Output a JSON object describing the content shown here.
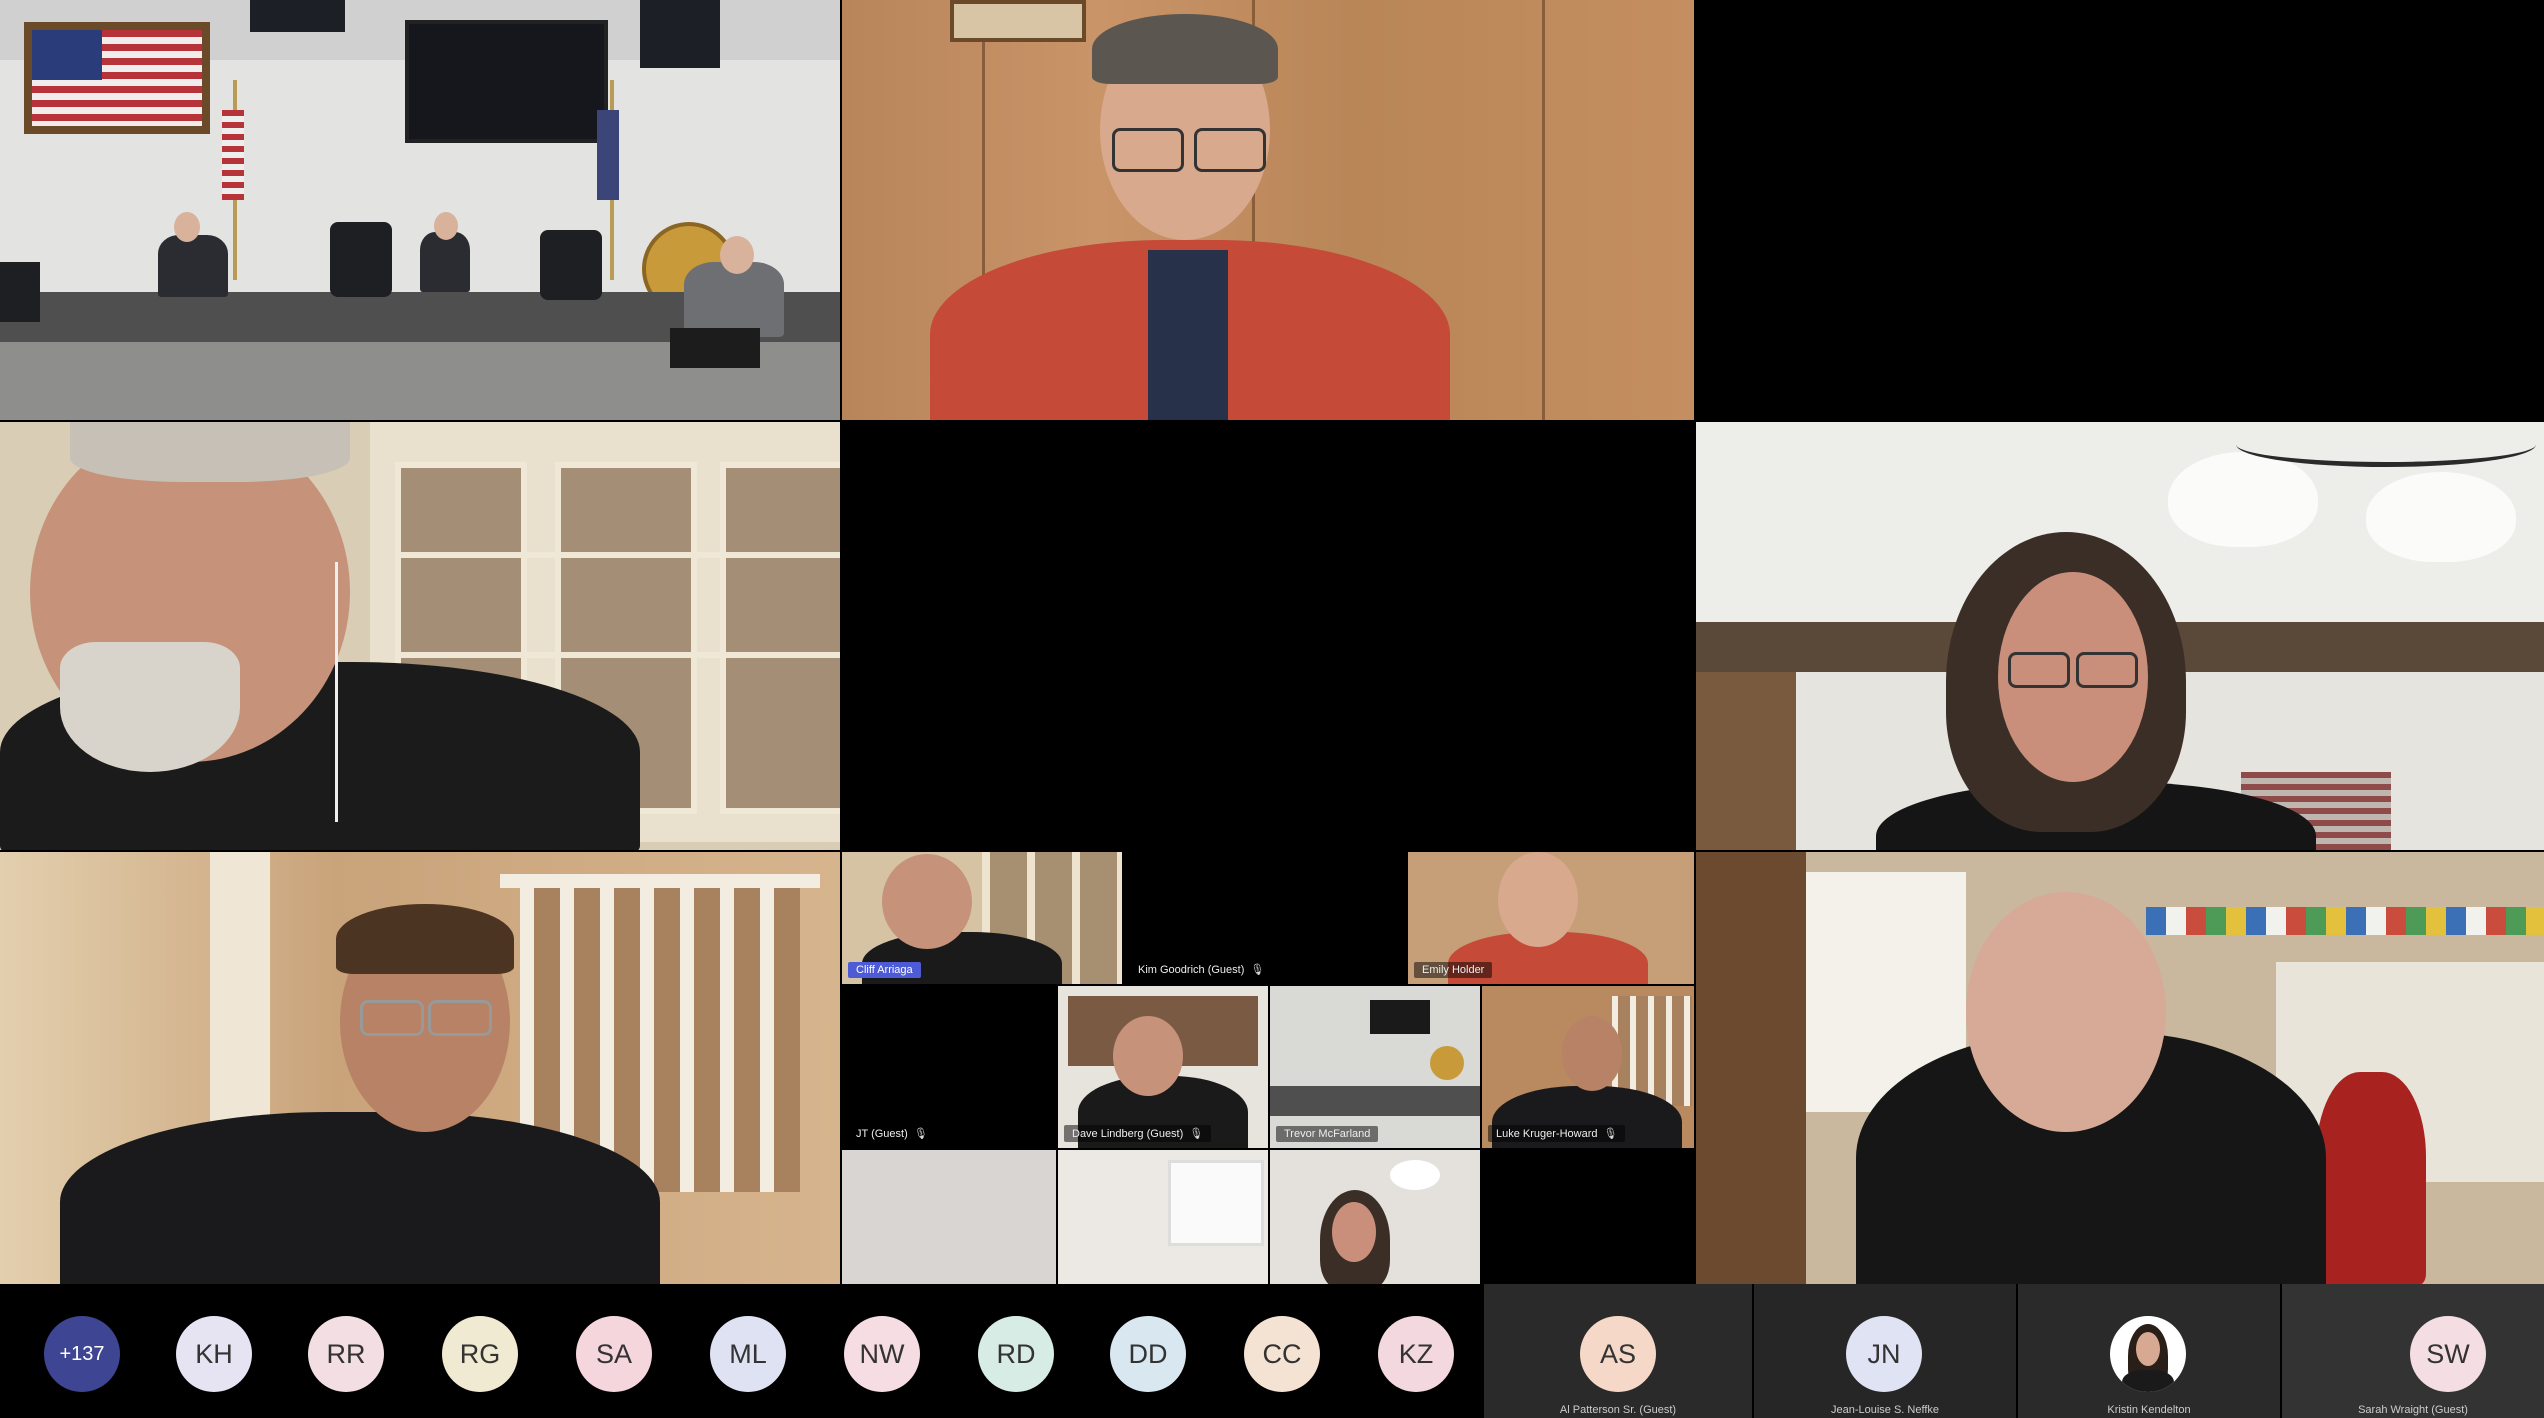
{
  "participants_small": [
    {
      "name": "Cliff Arriaga",
      "highlight": true
    },
    {
      "name": "Kim Goodrich (Guest)"
    },
    {
      "name": "Emily Holder"
    },
    {
      "name": "JT (Guest)"
    },
    {
      "name": "Dave Lindberg (Guest)"
    },
    {
      "name": "Trevor McFarland"
    },
    {
      "name": "Luke Kruger-Howard"
    }
  ],
  "roster": {
    "overflow": "+137",
    "avatars": [
      {
        "initials": "KH",
        "color": "#e6e3f3"
      },
      {
        "initials": "RR",
        "color": "#f3dfe3"
      },
      {
        "initials": "RG",
        "color": "#f0ead2"
      },
      {
        "initials": "SA",
        "color": "#f6d6dd"
      },
      {
        "initials": "ML",
        "color": "#dfe2f3"
      },
      {
        "initials": "NW",
        "color": "#f6dce3"
      },
      {
        "initials": "RD",
        "color": "#d7ece4"
      },
      {
        "initials": "DD",
        "color": "#d9e8f0"
      },
      {
        "initials": "CC",
        "color": "#f4e3d3"
      },
      {
        "initials": "KZ",
        "color": "#f3d9df"
      }
    ],
    "video_cards": [
      {
        "initials": "AS",
        "name": "Al Patterson Sr. (Guest)",
        "color": "#f6d8c9"
      },
      {
        "initials": "JN",
        "name": "Jean-Louise S. Neffke",
        "color": "#e0e3f3"
      },
      {
        "initials": "",
        "name": "Kristin Kendelton",
        "color": "#ffffff"
      },
      {
        "initials": "SW",
        "name": "Sarah Wraight (Guest)",
        "color": "#f4dde3"
      }
    ]
  }
}
